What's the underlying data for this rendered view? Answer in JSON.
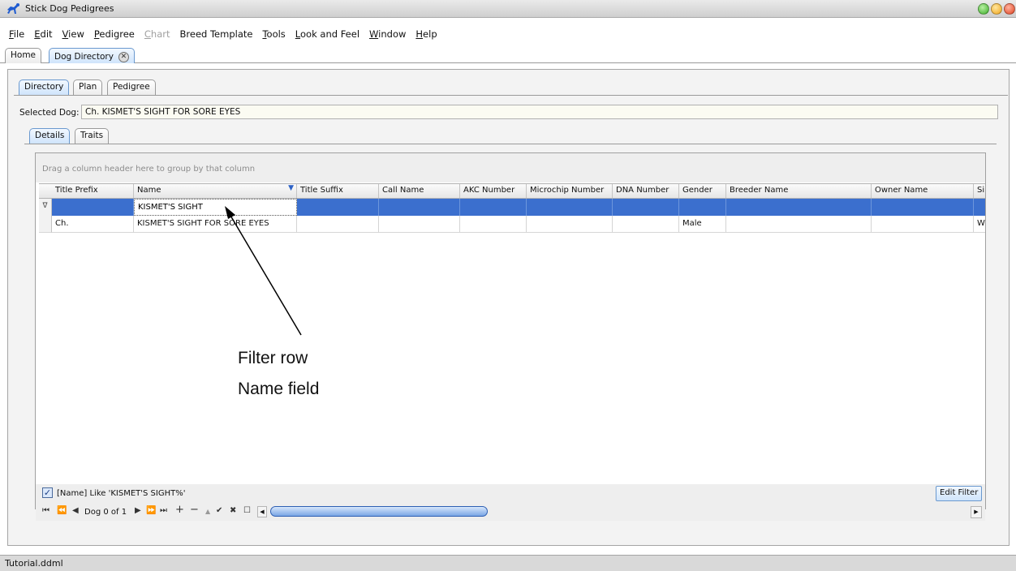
{
  "window": {
    "title": "Stick Dog Pedigrees"
  },
  "menu": {
    "items": [
      {
        "key": "F",
        "rest": "ile",
        "disabled": false
      },
      {
        "key": "E",
        "rest": "dit",
        "disabled": false
      },
      {
        "key": "V",
        "rest": "iew",
        "disabled": false
      },
      {
        "key": "P",
        "rest": "edigree",
        "disabled": false
      },
      {
        "key": "C",
        "rest": "hart",
        "disabled": true
      },
      {
        "key": "",
        "rest": "Breed Template",
        "disabled": false
      },
      {
        "key": "T",
        "rest": "ools",
        "disabled": false
      },
      {
        "key": "L",
        "rest": "ook and Feel",
        "disabled": false
      },
      {
        "key": "W",
        "rest": "indow",
        "disabled": false
      },
      {
        "key": "H",
        "rest": "elp",
        "disabled": false
      }
    ]
  },
  "top_tabs": {
    "home": "Home",
    "dog_directory": "Dog Directory",
    "close_symbol": "✕"
  },
  "sub_tabs": {
    "directory": "Directory",
    "plan": "Plan",
    "pedigree": "Pedigree"
  },
  "selected_dog": {
    "label": "Selected Dog:",
    "value": "Ch. KISMET'S SIGHT FOR SORE EYES"
  },
  "detail_tabs": {
    "details": "Details",
    "traits": "Traits"
  },
  "grid": {
    "group_hint": "Drag a column header here to group by that column",
    "columns": [
      "Title Prefix",
      "Name",
      "Title Suffix",
      "Call Name",
      "AKC Number",
      "Microchip Number",
      "DNA Number",
      "Gender",
      "Breeder Name",
      "Owner Name",
      "Si"
    ],
    "filter_row": {
      "indicator": "∇",
      "name": "KISMET'S SIGHT"
    },
    "rows": [
      {
        "title_prefix": "Ch.",
        "name": "KISMET'S SIGHT FOR SORE EYES",
        "title_suffix": "",
        "call_name": "",
        "akc_number": "",
        "microchip_number": "",
        "dna_number": "",
        "gender": "Male",
        "breeder_name": "",
        "owner_name": "",
        "si": "W"
      }
    ]
  },
  "annotation": {
    "line1": "Filter row",
    "line2": "Name field"
  },
  "filter_bar": {
    "checked": true,
    "expression": "[Name] Like 'KISMET'S SIGHT%'",
    "edit_button": "Edit Filter"
  },
  "navigator": {
    "first": "⏮",
    "prev_page": "⏪",
    "prev": "◀",
    "counter": "Dog 0 of 1",
    "next": "▶",
    "next_page": "⏩",
    "last": "⏭",
    "add": "+",
    "delete": "−",
    "edit": "▲",
    "post": "✔",
    "cancel": "✖",
    "refresh": "☐"
  },
  "status": {
    "text": "Tutorial.ddml"
  },
  "colors": {
    "selection": "#3b6fce",
    "accent": "#2d62c6"
  }
}
